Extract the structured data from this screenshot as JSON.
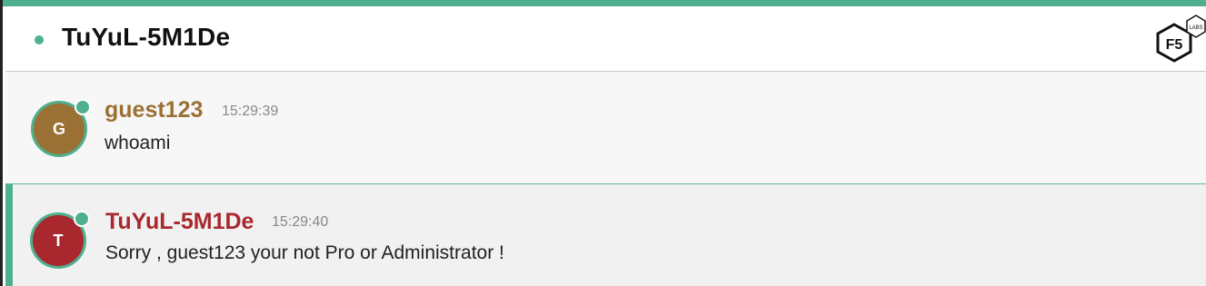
{
  "header": {
    "room_title": "TuYuL-5M1De",
    "logo_text": "F5",
    "logo_badge": "LABS"
  },
  "colors": {
    "accent": "#4fb08e",
    "user_guest": "#9b7034",
    "user_bot": "#a8282d"
  },
  "messages": [
    {
      "avatar_initial": "G",
      "username": "guest123",
      "time": "15:29:39",
      "text": "whoami"
    },
    {
      "avatar_initial": "T",
      "username": "TuYuL-5M1De",
      "time": "15:29:40",
      "text": "Sorry , guest123 your not Pro or Administrator !"
    }
  ]
}
